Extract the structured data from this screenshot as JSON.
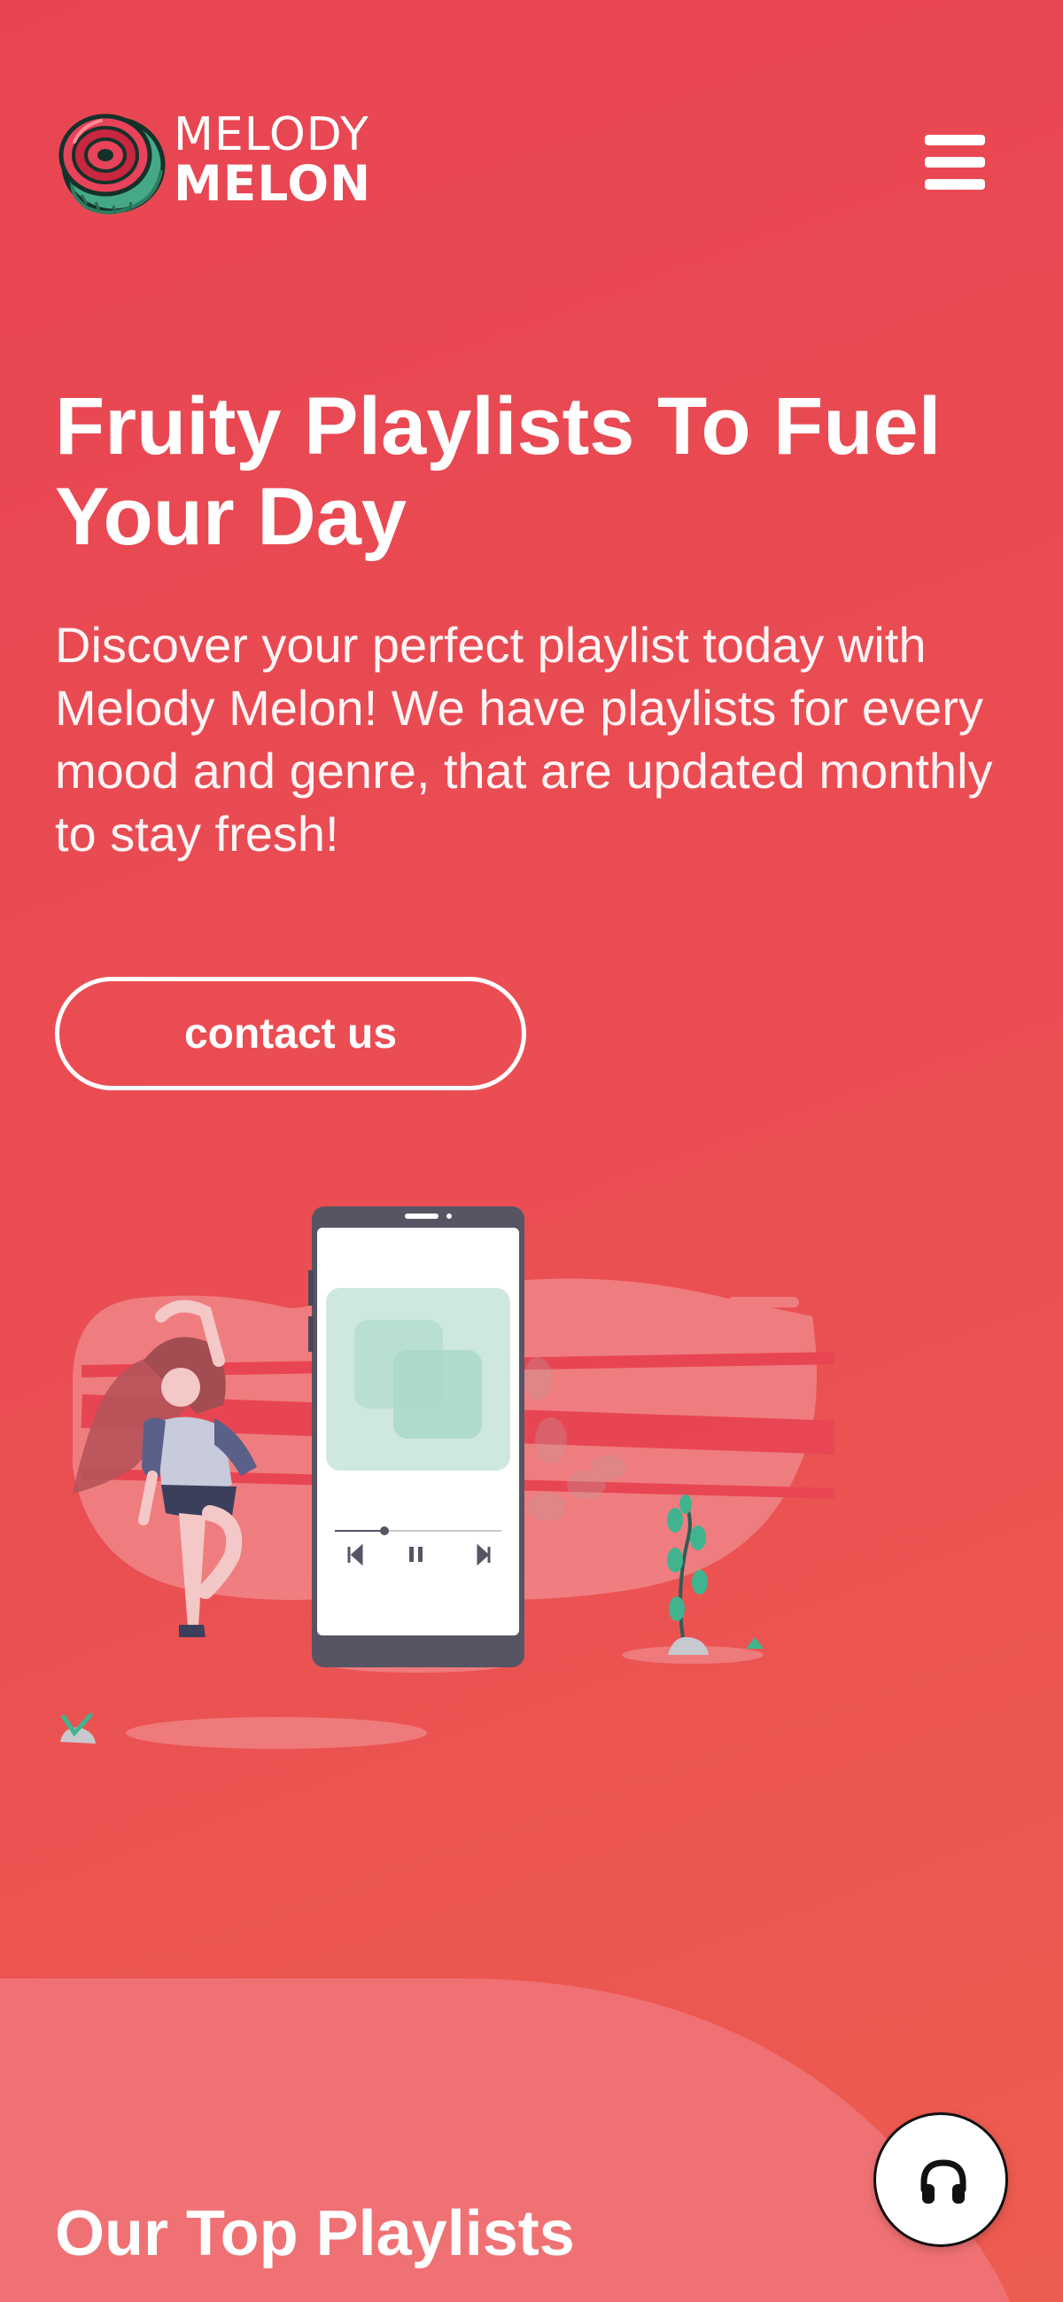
{
  "header": {
    "logo": {
      "line1": "MELODY",
      "line2": "MELON",
      "icon": "watermelon-logo-icon"
    },
    "menu_icon": "hamburger-menu-icon"
  },
  "hero": {
    "title": "Fruity Playlists To Fuel Your Day",
    "description": "Discover your perfect playlist today with Melody Melon! We have playlists for every mood and genre, that are updated monthly to stay fresh!",
    "cta_label": "contact us",
    "illustration": "woman-dancing-with-music-player-illustration"
  },
  "sections": {
    "top_playlists_title": "Our Top Playlists"
  },
  "floating_player": {
    "icon": "headphones-icon"
  },
  "colors": {
    "background": "#e84553",
    "accent_green": "#3fb48f",
    "text": "#ffffff"
  }
}
